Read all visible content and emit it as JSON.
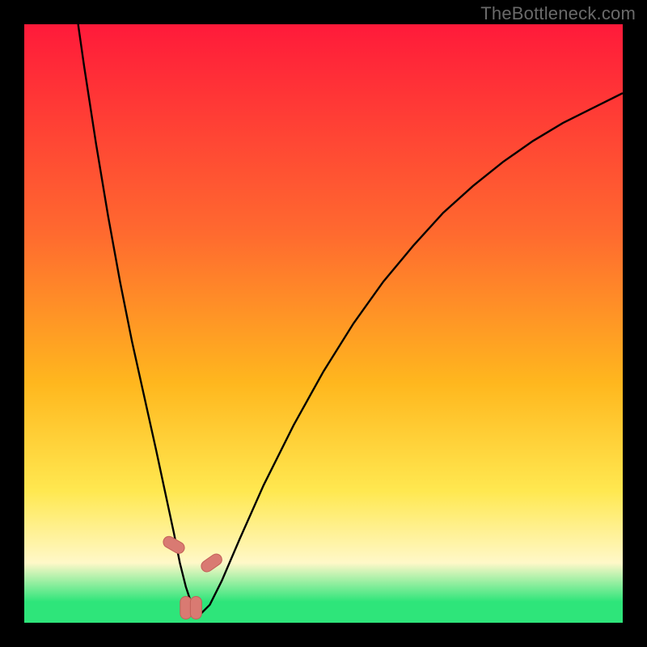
{
  "watermark": "TheBottleneck.com",
  "colors": {
    "black": "#000000",
    "curve": "#000000",
    "marker_fill": "#d97a72",
    "marker_stroke": "#c26058",
    "grad_top": "#ff1a3a",
    "grad_mid1": "#ff6a2f",
    "grad_mid2": "#ffb71e",
    "grad_mid3": "#ffe850",
    "grad_pale": "#fff8c8",
    "grad_green": "#2ee57a",
    "watermark_color": "#6a6a6a"
  },
  "chart_data": {
    "type": "line",
    "title": "",
    "xlabel": "",
    "ylabel": "",
    "xlim": [
      0,
      100
    ],
    "ylim": [
      0,
      100
    ],
    "series": [
      {
        "name": "bottleneck-curve",
        "x": [
          9,
          10,
          12,
          14,
          16,
          18,
          20,
          22,
          23.5,
          25,
          26,
          27,
          28,
          29.5,
          31,
          33,
          36,
          40,
          45,
          50,
          55,
          60,
          65,
          70,
          75,
          80,
          85,
          90,
          95,
          100
        ],
        "values": [
          100,
          93,
          80,
          68,
          57,
          47,
          38,
          29,
          22,
          15,
          10,
          6,
          3,
          1.5,
          3,
          7,
          14,
          23,
          33,
          42,
          50,
          57,
          63,
          68.5,
          73,
          77,
          80.5,
          83.5,
          86,
          88.5
        ]
      }
    ],
    "markers": [
      {
        "x": 25.0,
        "y": 13,
        "angle": -60
      },
      {
        "x": 27.0,
        "y": 2.5,
        "angle": 0
      },
      {
        "x": 28.7,
        "y": 2.5,
        "angle": 0
      },
      {
        "x": 31.3,
        "y": 10,
        "angle": 55
      }
    ],
    "gradient_stops": [
      {
        "offset": 0.0,
        "color_key": "grad_top"
      },
      {
        "offset": 0.35,
        "color_key": "grad_mid1"
      },
      {
        "offset": 0.6,
        "color_key": "grad_mid2"
      },
      {
        "offset": 0.78,
        "color_key": "grad_mid3"
      },
      {
        "offset": 0.9,
        "color_key": "grad_pale"
      },
      {
        "offset": 0.965,
        "color_key": "grad_green"
      },
      {
        "offset": 1.0,
        "color_key": "grad_green"
      }
    ]
  }
}
